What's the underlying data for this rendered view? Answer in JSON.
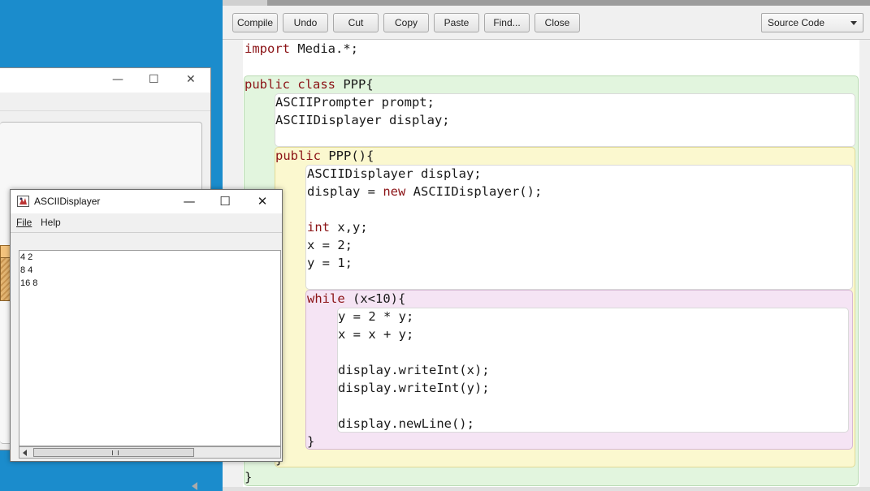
{
  "background_window": {
    "minimize": "—",
    "maximize": "☐",
    "close": "✕"
  },
  "toolbar": {
    "compile": "Compile",
    "undo": "Undo",
    "cut": "Cut",
    "copy": "Copy",
    "paste": "Paste",
    "find": "Find...",
    "close": "Close",
    "view_select": "Source Code"
  },
  "code": {
    "import": {
      "kw": "import",
      "rest": " Media.*;"
    },
    "class_decl": {
      "kw1": "public",
      "sp": " ",
      "kw2": "class",
      "rest": " PPP{"
    },
    "field1": "ASCIIPrompter prompt;",
    "field2": "ASCIIDisplayer display;",
    "ctor_decl": {
      "kw": "public",
      "rest": " PPP(){"
    },
    "ctor_line1": "ASCIIDisplayer display;",
    "ctor_line2": {
      "pre": "display = ",
      "kw": "new",
      "rest": " ASCIIDisplayer();"
    },
    "ctor_line3": {
      "kw": "int",
      "rest": " x,y;"
    },
    "ctor_line4": "x = 2;",
    "ctor_line5": "y = 1;",
    "while_decl": {
      "kw": "while",
      "rest": " (x<10){"
    },
    "while_line1": "y = 2 * y;",
    "while_line2": "x = x + y;",
    "while_line3": "display.writeInt(x);",
    "while_line4": "display.writeInt(y);",
    "while_line5": "display.newLine();",
    "close_while": "}",
    "close_ctor": "}",
    "close_class": "}"
  },
  "ascii_displayer": {
    "title": "ASCIIDisplayer",
    "minimize": "—",
    "maximize": "☐",
    "close": "✕",
    "menu_file": "File",
    "menu_help": "Help",
    "output_lines": [
      "4 2",
      "8 4",
      "16 8"
    ]
  }
}
